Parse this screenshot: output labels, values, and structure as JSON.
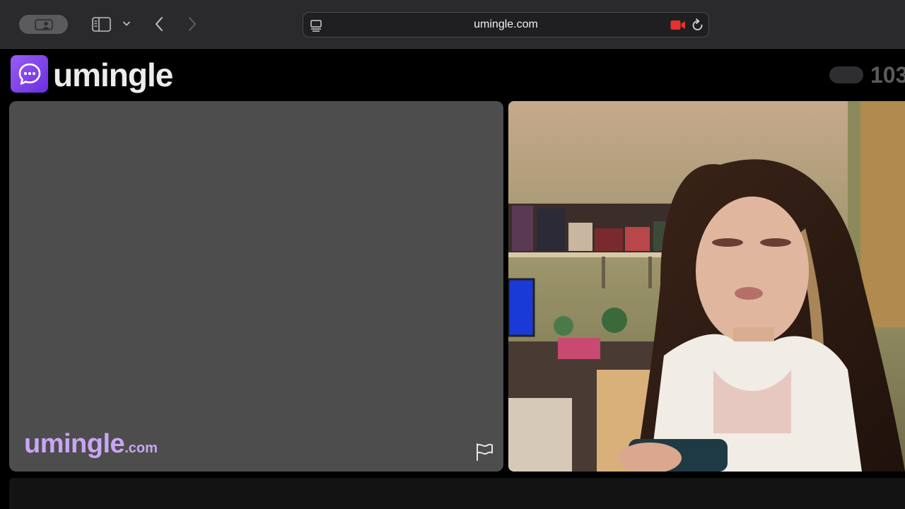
{
  "browser": {
    "url": "umingle.com",
    "icons": {
      "tab_overview": "profile-tab-icon",
      "sidebar": "sidebar-icon",
      "sidebar_menu": "chevron-down-icon",
      "back": "chevron-left-icon",
      "forward": "chevron-right-icon",
      "page_menu": "page-menu-icon",
      "camera_in_use": "video-camera-icon",
      "reload": "reload-icon"
    },
    "camera_icon_color": "#e5322d"
  },
  "site": {
    "brand": "umingle",
    "logo_icon": "chat-bubble-icon",
    "brand_color": "#7c3aed",
    "online_count": "103",
    "watermark_main": "umingle",
    "watermark_suffix": ".com",
    "report_icon": "flag-icon"
  }
}
